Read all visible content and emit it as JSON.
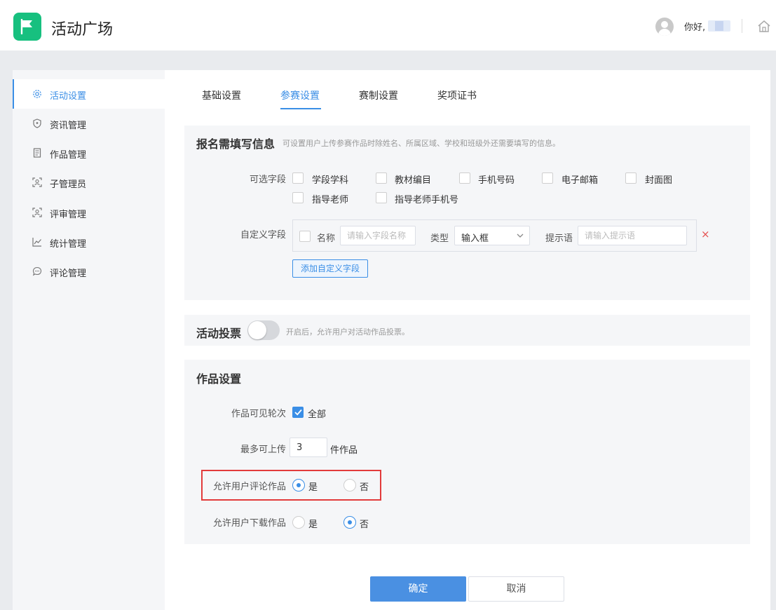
{
  "header": {
    "app_title": "活动广场",
    "greeting": "你好,"
  },
  "sidebar": {
    "items": [
      {
        "label": "活动设置",
        "icon": "gear-icon",
        "active": true
      },
      {
        "label": "资讯管理",
        "icon": "shield-icon"
      },
      {
        "label": "作品管理",
        "icon": "document-icon"
      },
      {
        "label": "子管理员",
        "icon": "user-scan-icon"
      },
      {
        "label": "评审管理",
        "icon": "user-scan-icon"
      },
      {
        "label": "统计管理",
        "icon": "chart-line-icon"
      },
      {
        "label": "评论管理",
        "icon": "comment-icon"
      }
    ]
  },
  "tabs": [
    {
      "label": "基础设置"
    },
    {
      "label": "参赛设置",
      "active": true
    },
    {
      "label": "赛制设置"
    },
    {
      "label": "奖项证书"
    }
  ],
  "registration": {
    "title": "报名需填写信息",
    "hint": "可设置用户上传参赛作品时除姓名、所属区域、学校和班级外还需要填写的信息。",
    "optional_label": "可选字段",
    "optional_fields": [
      "学段学科",
      "教材编目",
      "手机号码",
      "电子邮箱",
      "封面图",
      "指导老师",
      "指导老师手机号"
    ],
    "custom_label": "自定义字段",
    "custom_field": {
      "name_label": "名称",
      "name_placeholder": "请输入字段名称",
      "type_label": "类型",
      "type_value": "输入框",
      "hint_label": "提示语",
      "hint_placeholder": "请输入提示语",
      "remove": "×"
    },
    "add_button": "添加自定义字段"
  },
  "voting": {
    "title": "活动投票",
    "hint": "开启后，允许用户对活动作品投票。",
    "enabled": false
  },
  "works": {
    "title": "作品设置",
    "visible_rounds_label": "作品可见轮次",
    "visible_rounds_option": "全部",
    "max_upload_label": "最多可上传",
    "max_upload_value": "3",
    "max_upload_unit": "件作品",
    "allow_comment_label": "允许用户评论作品",
    "allow_download_label": "允许用户下载作品",
    "yes": "是",
    "no": "否",
    "allow_comment": "yes",
    "allow_download": "no"
  },
  "actions": {
    "confirm": "确定",
    "cancel": "取消"
  },
  "colors": {
    "accent": "#3a8ee6",
    "logo": "#17c07f",
    "highlight": "#e23b3b"
  }
}
